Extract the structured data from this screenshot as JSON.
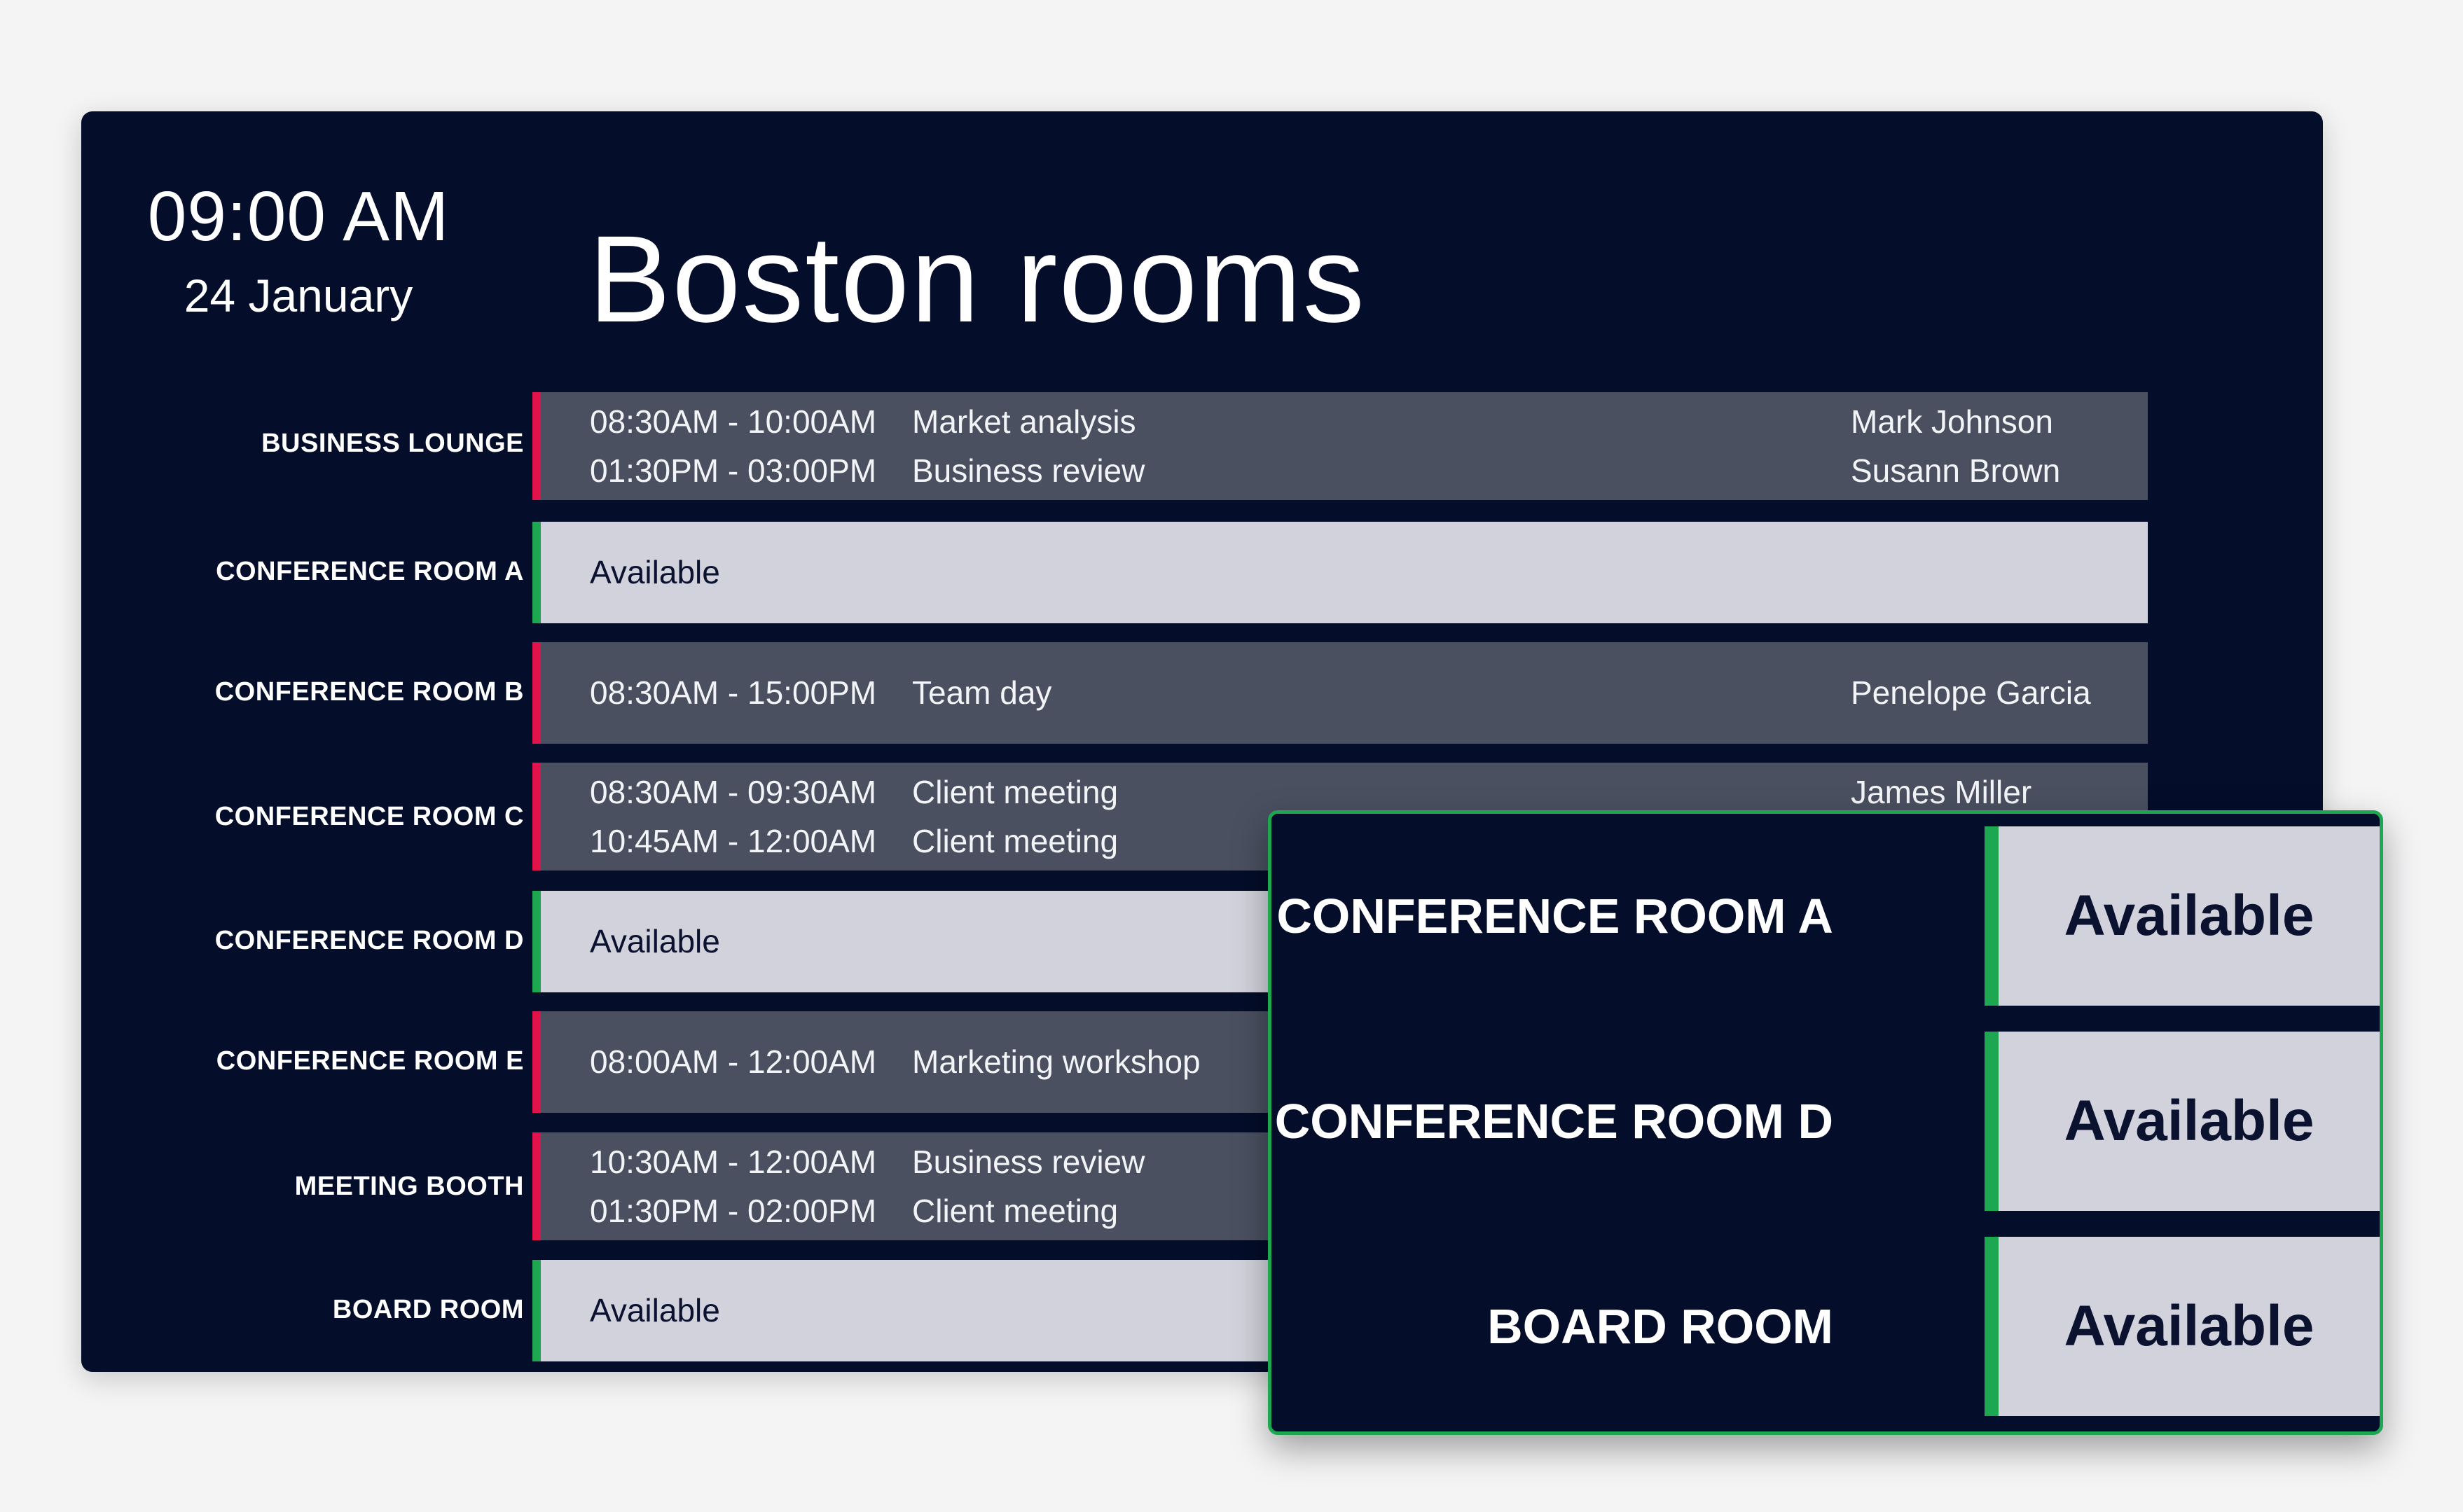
{
  "clock": {
    "time": "09:00 AM",
    "date": "24 January"
  },
  "title": "Boston rooms",
  "rooms": [
    {
      "name": "BUSINESS LOUNGE",
      "status": "busy",
      "bookings": [
        {
          "range": "08:30AM - 10:00AM",
          "title": "Market analysis",
          "person": "Mark Johnson"
        },
        {
          "range": "01:30PM - 03:00PM",
          "title": "Business review",
          "person": "Susann Brown"
        }
      ]
    },
    {
      "name": "CONFERENCE ROOM A",
      "status": "free",
      "text": "Available"
    },
    {
      "name": "CONFERENCE ROOM B",
      "status": "busy",
      "bookings": [
        {
          "range": "08:30AM - 15:00PM",
          "title": "Team day",
          "person": "Penelope Garcia"
        }
      ]
    },
    {
      "name": "CONFERENCE ROOM C",
      "status": "busy",
      "bookings": [
        {
          "range": "08:30AM - 09:30AM",
          "title": "Client meeting",
          "person": "James Miller"
        },
        {
          "range": "10:45AM - 12:00AM",
          "title": "Client meeting",
          "person": ""
        }
      ]
    },
    {
      "name": "CONFERENCE ROOM D",
      "status": "free",
      "text": "Available"
    },
    {
      "name": "CONFERENCE ROOM E",
      "status": "busy",
      "bookings": [
        {
          "range": "08:00AM - 12:00AM",
          "title": "Marketing workshop",
          "person": ""
        }
      ]
    },
    {
      "name": "MEETING BOOTH",
      "status": "busy",
      "bookings": [
        {
          "range": "10:30AM - 12:00AM",
          "title": "Business review",
          "person": ""
        },
        {
          "range": "01:30PM - 02:00PM",
          "title": "Client meeting",
          "person": ""
        }
      ]
    },
    {
      "name": "BOARD ROOM",
      "status": "free",
      "text": "Available"
    }
  ],
  "overlay": {
    "rows": [
      {
        "name": "CONFERENCE ROOM A",
        "status": "Available"
      },
      {
        "name": "CONFERENCE ROOM D",
        "status": "Available"
      },
      {
        "name": "BOARD ROOM",
        "status": "Available"
      }
    ]
  },
  "colors": {
    "background": "#040d29",
    "busy_row": "#4a5060",
    "busy_accent": "#e0134a",
    "free_row": "#d2d2dc",
    "free_accent": "#1da750"
  }
}
